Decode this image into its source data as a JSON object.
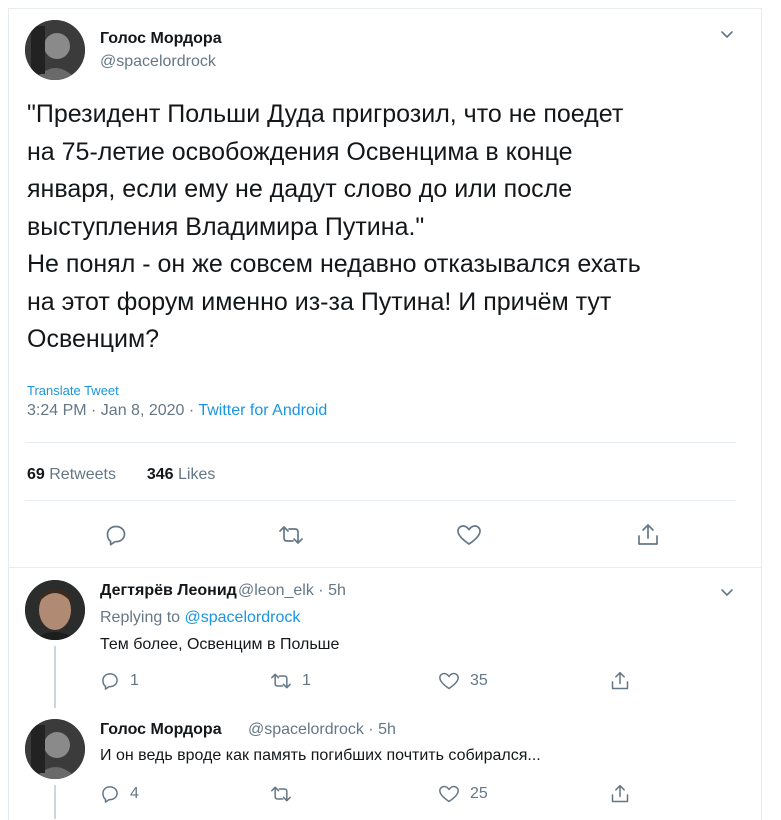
{
  "main_tweet": {
    "author_name": "Голос Мордора",
    "author_handle": "@spacelordrock",
    "text_lines": [
      "\"Президент Польши Дуда пригрозил, что не поедет",
      "на 75-летие освобождения Освенцима в конце",
      "января, если ему не дадут слово до или после",
      "выступления Владимира Путина.\"",
      "Не понял - он же совсем недавно отказывался ехать",
      "на этот форум именно из-за Путина! И причём тут",
      "Освенцим?"
    ],
    "translate_label": "Translate Tweet",
    "time": "3:24 PM · Jan 8, 2020 · ",
    "source_app": "Twitter for Android",
    "retweets_count": "69",
    "retweets_label": "Retweets",
    "likes_count": "346",
    "likes_label": "Likes"
  },
  "replies": [
    {
      "author_name": "Дегтярёв Леонид",
      "author_handle_time": "@leon_elk · 5h",
      "replying_prefix": "Replying to ",
      "replying_to": "@spacelordrock",
      "text": "Тем более, Освенцим в Польше",
      "reply_count": "1",
      "retweet_count": "1",
      "like_count": "35"
    },
    {
      "author_name": "Голос Мордора",
      "author_handle_time": "@spacelordrock · 5h",
      "text": "И он ведь вроде как память погибших почтить собирался...",
      "reply_count": "4",
      "retweet_count": "",
      "like_count": "25"
    }
  ],
  "colors": {
    "accent": "#1b95e0",
    "secondary_text": "#657786",
    "border": "#e6ecf0"
  },
  "icons": [
    "chevron-down-icon",
    "reply-icon",
    "retweet-icon",
    "like-icon",
    "share-icon"
  ]
}
